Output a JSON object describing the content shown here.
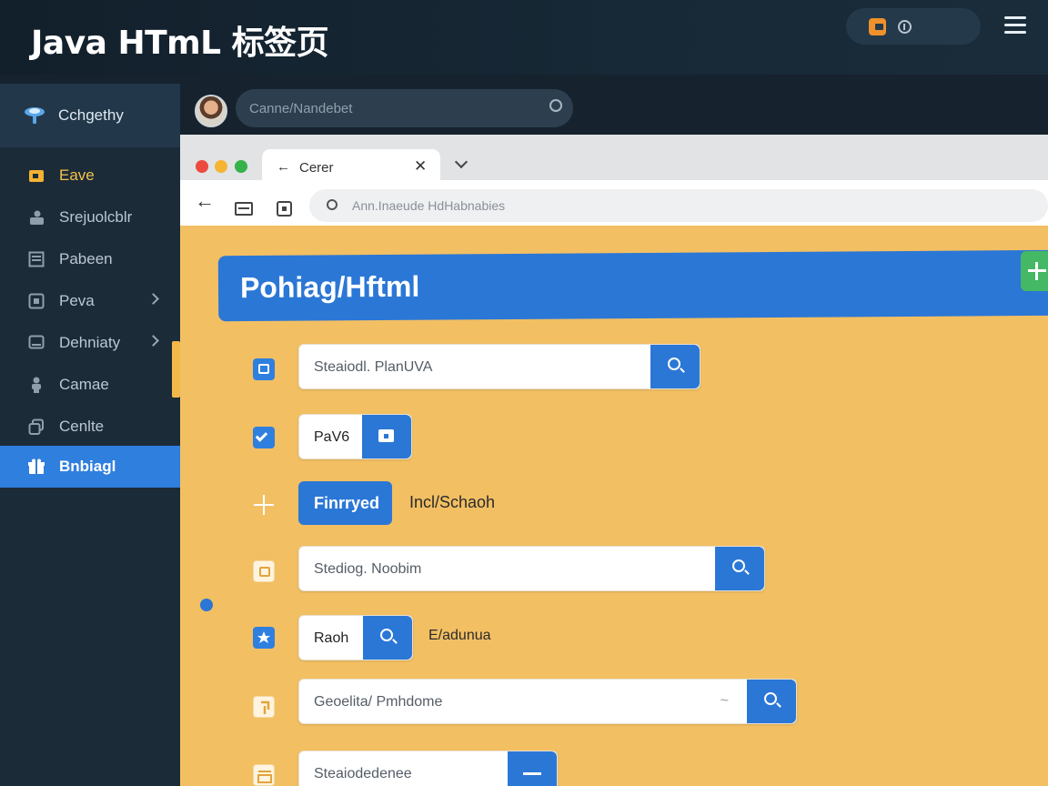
{
  "app": {
    "title": "Java HTmL 标签页",
    "menu_icon": "hamburger-menu-icon",
    "pill_icons": [
      "orange-folder-icon",
      "info-icon"
    ]
  },
  "sidebar": {
    "header_label": "Cchgethy",
    "header_icon": "ufo-logo-icon",
    "items": [
      {
        "label": "Eave",
        "icon": "folder-icon",
        "highlight": "#f2c24a"
      },
      {
        "label": "Srejuolcblr",
        "icon": "user-icon"
      },
      {
        "label": "Pabeen",
        "icon": "document-icon"
      },
      {
        "label": "Peva",
        "icon": "square-icon",
        "has_chevron": true
      },
      {
        "label": "Dehniaty",
        "icon": "monitor-icon",
        "has_chevron": true
      },
      {
        "label": "Camae",
        "icon": "person-icon"
      },
      {
        "label": "Cenlte",
        "icon": "copy-icon"
      },
      {
        "label": "Bnbiagl",
        "icon": "gift-icon",
        "active": true
      }
    ]
  },
  "profile_bar": {
    "search_text": "Canne/Nandebet"
  },
  "browser": {
    "tab_label": "Cerer",
    "address_text": "Ann.Inaeude HdHabnabies"
  },
  "page": {
    "banner_title": "Pohiag/Hftml",
    "rows": [
      {
        "type": "search",
        "value": "Steaiodl. PlanUVA",
        "icon": "blue-box-icon"
      },
      {
        "type": "folder",
        "value": "PaV6",
        "icon": "checkbox-checked-icon"
      },
      {
        "type": "button",
        "button_label": "Finrryed",
        "side_text": "Incl/Schaoh",
        "icon": "plus-icon"
      },
      {
        "type": "search",
        "value": "Stediog. Noobim",
        "icon": "light-box-icon"
      },
      {
        "type": "search",
        "value": "Raoh",
        "side_text": "E/adunua",
        "icon": "star-badge-icon"
      },
      {
        "type": "search",
        "value": "Geoelita/ Pmhdome",
        "icon": "light-arrow-icon"
      },
      {
        "type": "minus",
        "value": "Steaiodedenee",
        "icon": "light-tray-icon"
      }
    ]
  },
  "colors": {
    "accent_blue": "#2b77d6",
    "sidebar_bg": "#1c2b38",
    "page_bg": "#f2bf63",
    "add_green": "#45b865",
    "active_yellow": "#f1b949"
  }
}
